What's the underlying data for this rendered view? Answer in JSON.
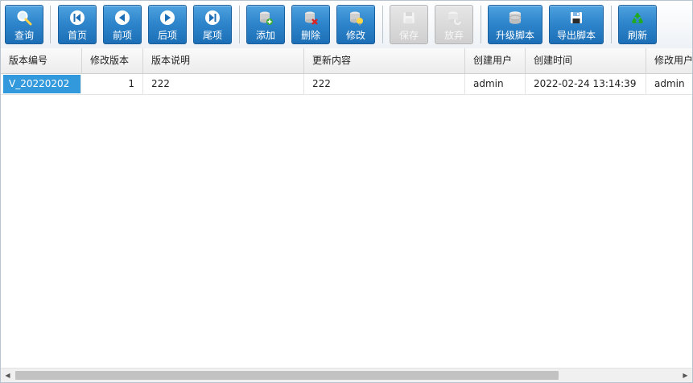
{
  "toolbar": {
    "buttons": [
      {
        "label": "查询",
        "icon": "search-icon"
      },
      {
        "label": "首页",
        "icon": "first-page-icon"
      },
      {
        "label": "前项",
        "icon": "previous-icon"
      },
      {
        "label": "后项",
        "icon": "next-icon"
      },
      {
        "label": "尾项",
        "icon": "last-page-icon"
      },
      {
        "label": "添加",
        "icon": "add-database-icon"
      },
      {
        "label": "删除",
        "icon": "delete-database-icon"
      },
      {
        "label": "修改",
        "icon": "edit-database-icon"
      },
      {
        "label": "保存",
        "icon": "save-icon",
        "disabled": true
      },
      {
        "label": "放弃",
        "icon": "discard-icon",
        "disabled": true
      },
      {
        "label": "升级脚本",
        "icon": "upgrade-script-icon"
      },
      {
        "label": "导出脚本",
        "icon": "export-script-icon"
      },
      {
        "label": "刷新",
        "icon": "refresh-icon"
      }
    ]
  },
  "table": {
    "columns": [
      "版本编号",
      "修改版本",
      "版本说明",
      "更新内容",
      "创建用户",
      "创建时间",
      "修改用户"
    ],
    "rows": [
      [
        "V_20220202",
        "1",
        "222",
        "222",
        "admin",
        "2022-02-24 13:14:39",
        "admin"
      ]
    ]
  },
  "colors": {
    "button_blue": "#2f86cc",
    "selected_cell": "#3399dd",
    "refresh_green": "#22aa22"
  },
  "scrollbar": {
    "horizontal_visible_fraction": 0.82,
    "horizontal_offset_fraction": 0
  }
}
